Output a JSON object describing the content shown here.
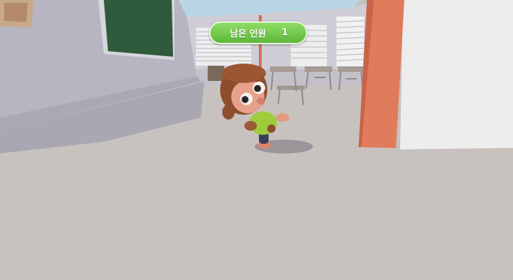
{
  "hud": {
    "remaining_label": "남은 인원",
    "remaining_count": "1"
  },
  "colors": {
    "hud_green": "#6cc84a",
    "floor": "#c8c2bf",
    "wall": "#b9b8c3",
    "chalkboard": "#2f5a3c",
    "pillar": "#e07b5c",
    "sky": "#b7d4e4"
  },
  "scene": {
    "character": "monkey-character",
    "props": [
      "chalkboard",
      "bulletin-board",
      "desks-and-chairs",
      "window-blinds",
      "pillar"
    ]
  }
}
